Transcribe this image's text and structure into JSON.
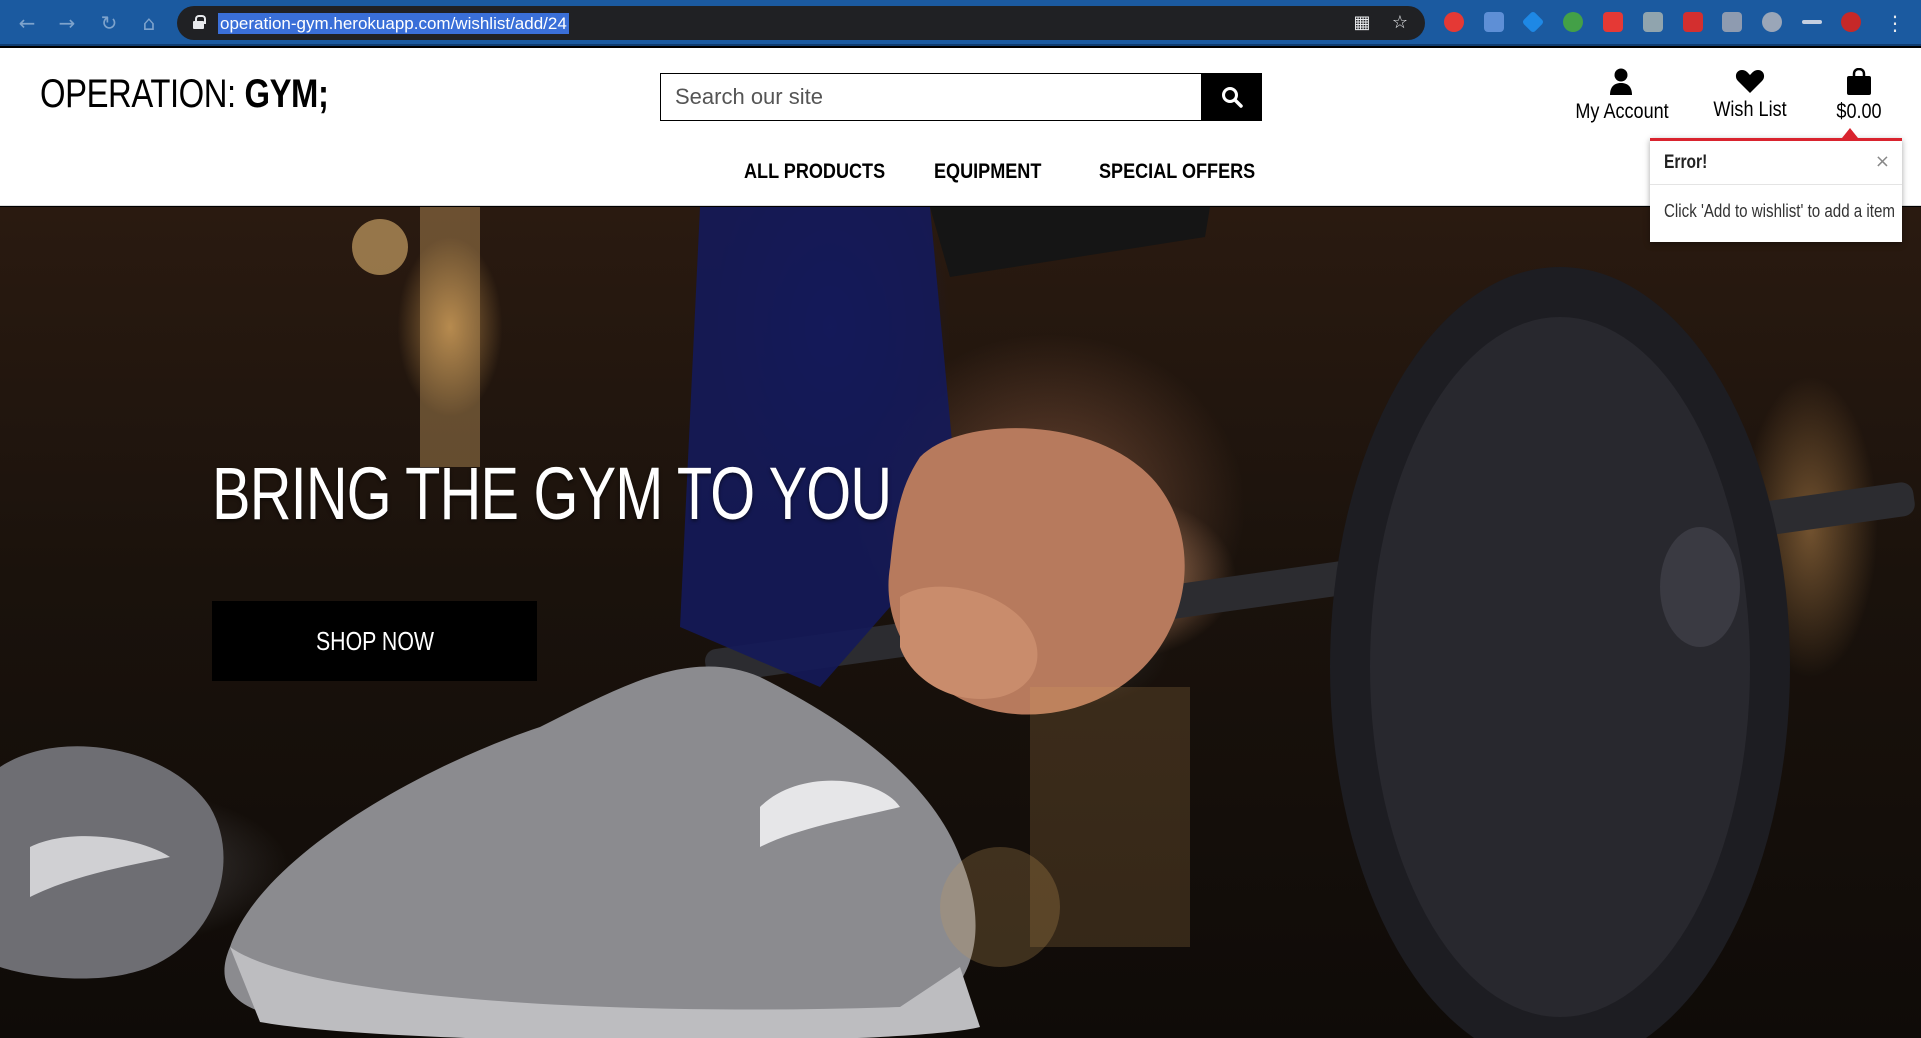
{
  "browser": {
    "url": "operation-gym.herokuapp.com/wishlist/add/24"
  },
  "site": {
    "logo_light": "OPERATION: ",
    "logo_bold": "GYM;",
    "search_placeholder": "Search our site",
    "account_label": "My Account",
    "wishlist_label": "Wish List",
    "cart_total": "$0.00"
  },
  "nav": {
    "items": [
      "ALL PRODUCTS",
      "EQUIPMENT",
      "SPECIAL OFFERS"
    ]
  },
  "toast": {
    "title": "Error!",
    "close": "×",
    "message": "Click 'Add to wishlist' to add a item"
  },
  "hero": {
    "title": "BRING THE GYM TO YOU",
    "button_label": "SHOP NOW"
  },
  "colors": {
    "browser_bar": "#1b5aa0",
    "toast_accent": "#d9232e"
  }
}
